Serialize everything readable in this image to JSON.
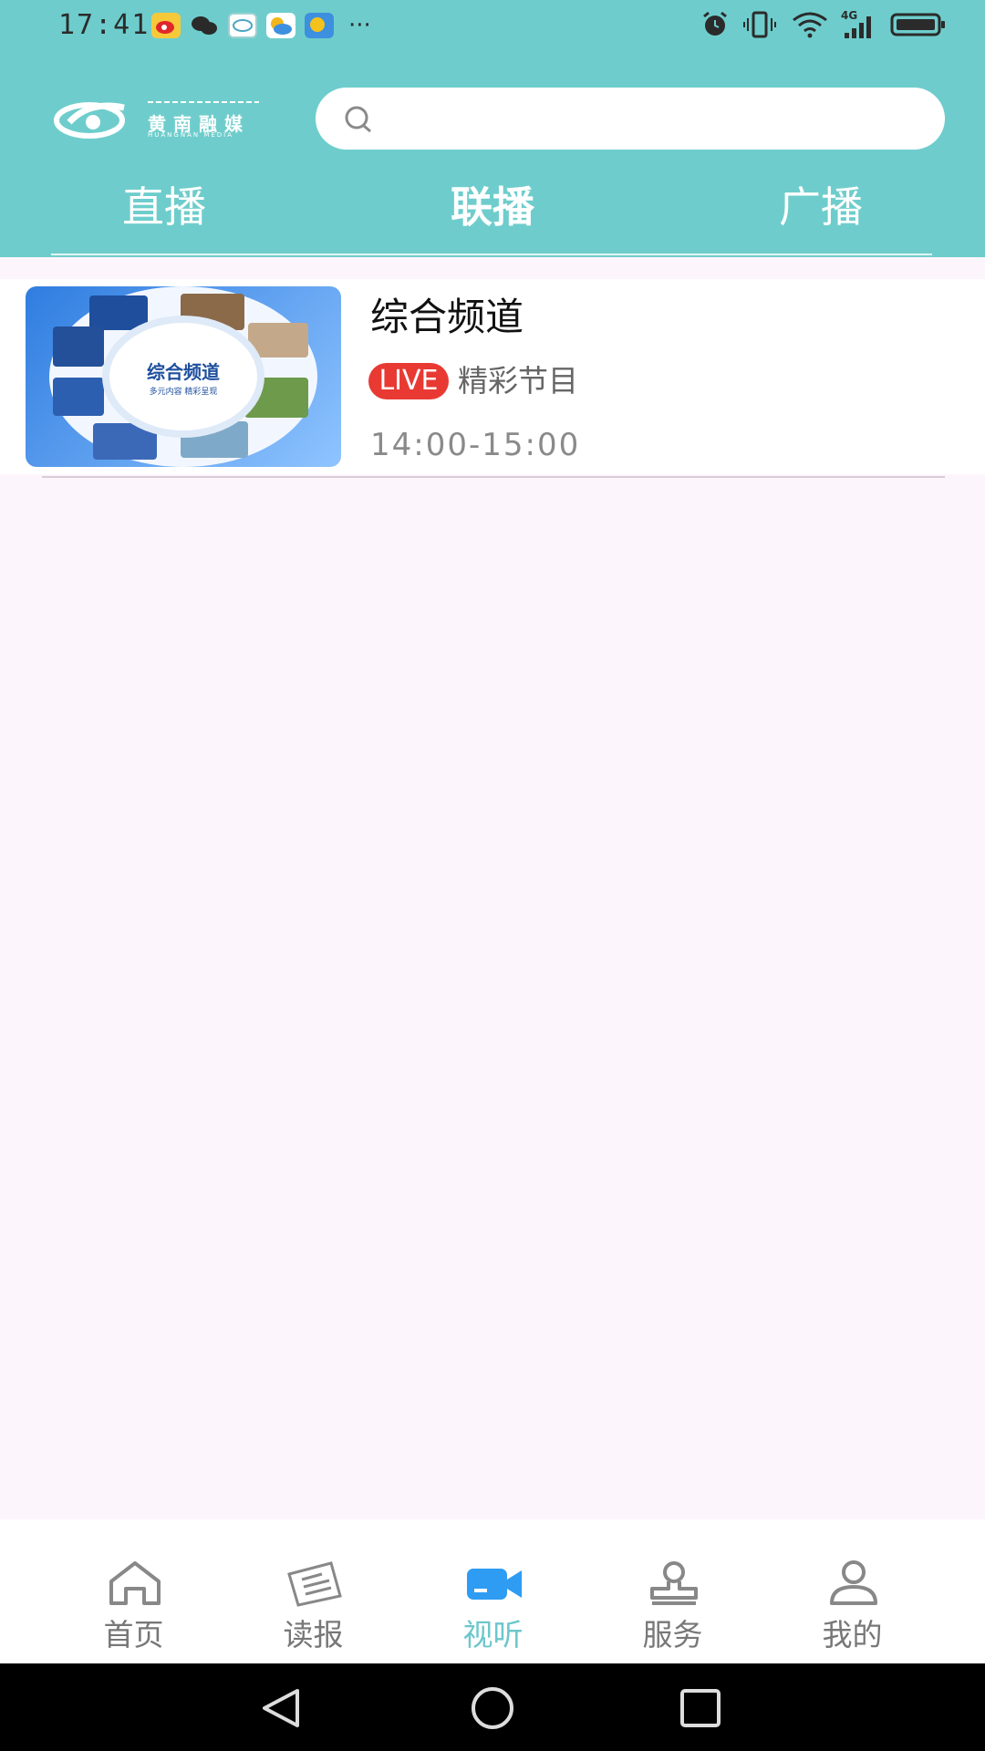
{
  "status_bar": {
    "time": "17:41",
    "apps": [
      "weibo-app-icon",
      "wechat-app-icon",
      "app-icon",
      "weather-app-icon",
      "weather-app-icon-2"
    ],
    "more": "···",
    "signal_label": "4G"
  },
  "header": {
    "logo_text": "黄南融媒",
    "logo_subtext": "HUANGNAN MEDIA",
    "search_placeholder": ""
  },
  "tabs": [
    {
      "label": "直播",
      "active": false
    },
    {
      "label": "联播",
      "active": true
    },
    {
      "label": "广播",
      "active": false
    }
  ],
  "list": [
    {
      "title": "综合频道",
      "badge": "LIVE",
      "program": "精彩节目",
      "time": "14:00-15:00",
      "thumb_title": "综合频道",
      "thumb_sub": "多元内容  精彩呈现"
    }
  ],
  "bottom_nav": [
    {
      "label": "首页",
      "icon": "home-icon",
      "active": false
    },
    {
      "label": "读报",
      "icon": "newspaper-icon",
      "active": false
    },
    {
      "label": "视听",
      "icon": "video-camera-icon",
      "active": true
    },
    {
      "label": "服务",
      "icon": "service-stamp-icon",
      "active": false
    },
    {
      "label": "我的",
      "icon": "user-icon",
      "active": false
    }
  ],
  "colors": {
    "header_bg": "#6ecdcc",
    "page_bg": "#fcf6fc",
    "live_badge": "#e83a33",
    "nav_active": "#6cc7cc",
    "nav_active_icon": "#2e9cf2"
  }
}
